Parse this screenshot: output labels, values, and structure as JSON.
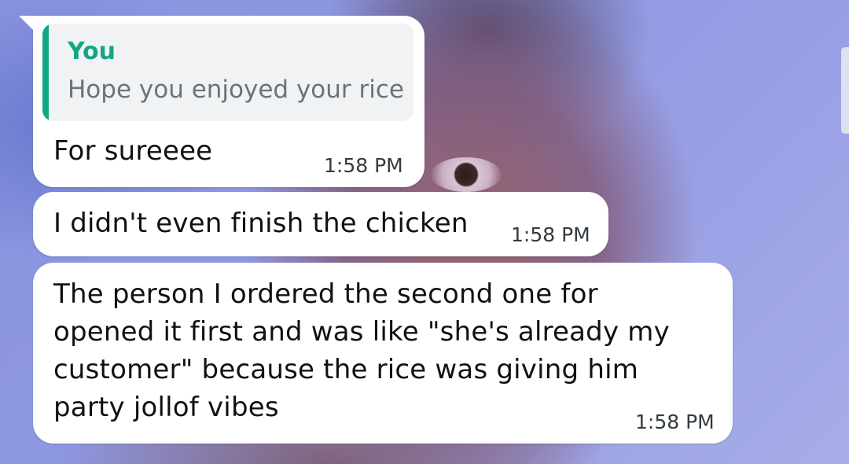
{
  "chat": {
    "messages": [
      {
        "reply": {
          "author": "You",
          "text": "Hope you enjoyed your rice"
        },
        "text": "For sureeee",
        "time": "1:58 PM"
      },
      {
        "text": "I didn't even finish the chicken",
        "time": "1:58 PM"
      },
      {
        "text": "The person I ordered the second one for\nopened it first and was like \"she's already my\ncustomer\" because the rice was giving him\nparty jollof vibes",
        "time": "1:58 PM"
      }
    ]
  }
}
